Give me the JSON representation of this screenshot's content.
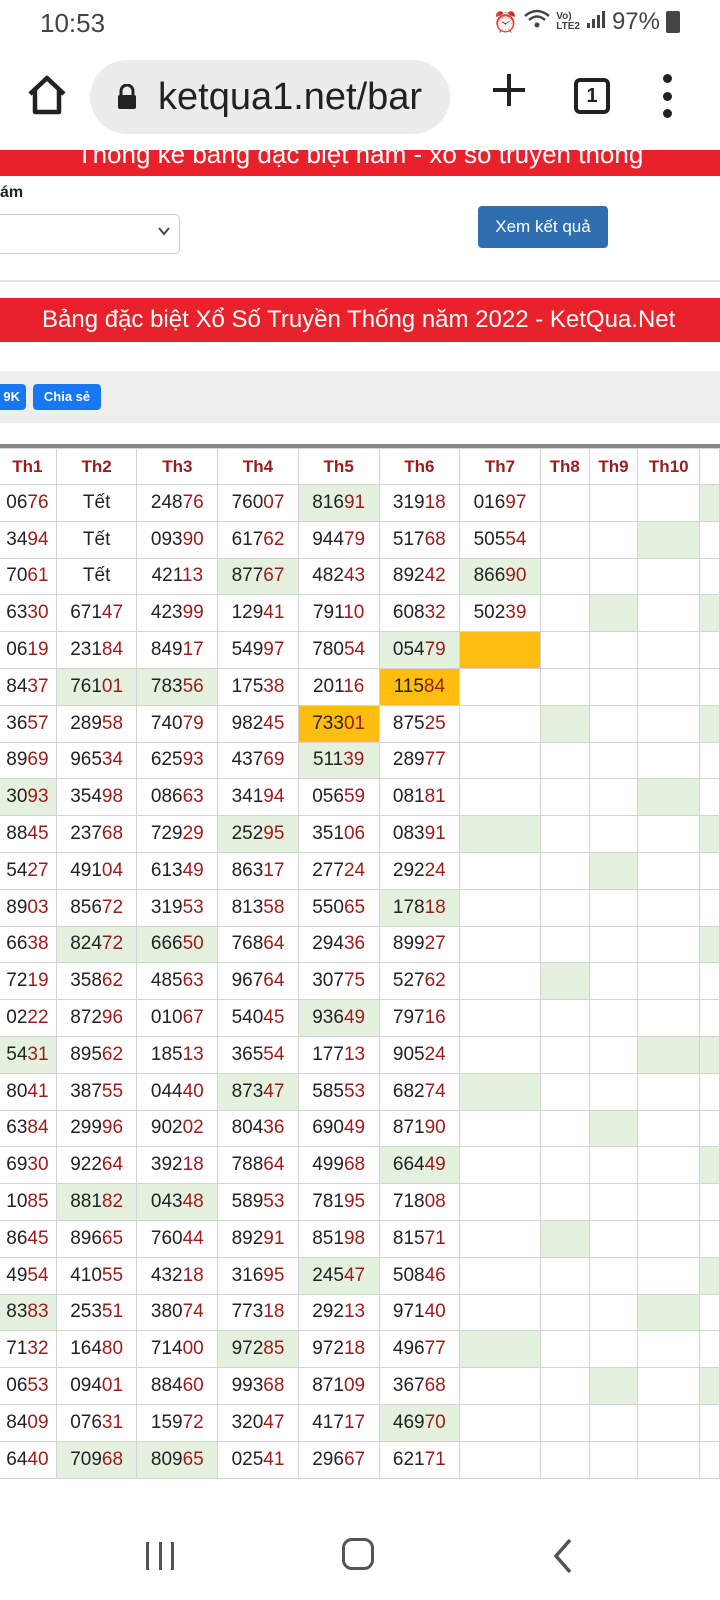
{
  "status": {
    "time": "10:53",
    "battery": "97%"
  },
  "browser": {
    "url": "ketqua1.net/bar",
    "tab_count": "1"
  },
  "form": {
    "top_banner": "Thống kê bảng đặc biệt năm - xổ số truyền thống",
    "year_label": "ám",
    "submit_label": "Xem kết quả"
  },
  "banner": "Bảng đặc biệt Xổ Số Truyền Thống năm 2022 - KetQua.Net",
  "share": {
    "count": "9K",
    "label": "Chia sẻ"
  },
  "table": {
    "headers": [
      "Th1",
      "Th2",
      "Th3",
      "Th4",
      "Th5",
      "Th6",
      "Th7",
      "Th8",
      "Th9",
      "Th10"
    ],
    "rows": [
      [
        "0676",
        "Tết",
        "24876",
        "76007",
        "81691",
        "31918",
        "01697",
        "",
        "",
        ""
      ],
      [
        "3494",
        "Tết",
        "09390",
        "61762",
        "94479",
        "51768",
        "50554",
        "",
        "",
        ""
      ],
      [
        "7061",
        "Tết",
        "42113",
        "87767",
        "48243",
        "89242",
        "86690",
        "",
        "",
        ""
      ],
      [
        "6330",
        "67147",
        "42399",
        "12941",
        "79110",
        "60832",
        "50239",
        "",
        "",
        ""
      ],
      [
        "0619",
        "23184",
        "84917",
        "54997",
        "78054",
        "05479",
        "",
        "",
        "",
        ""
      ],
      [
        "8437",
        "76101",
        "78356",
        "17538",
        "20116",
        "11584",
        "",
        "",
        "",
        ""
      ],
      [
        "3657",
        "28958",
        "74079",
        "98245",
        "73301",
        "87525",
        "",
        "",
        "",
        ""
      ],
      [
        "8969",
        "96534",
        "62593",
        "43769",
        "51139",
        "28977",
        "",
        "",
        "",
        ""
      ],
      [
        "3093",
        "35498",
        "08663",
        "34194",
        "05659",
        "08181",
        "",
        "",
        "",
        ""
      ],
      [
        "8845",
        "23768",
        "72929",
        "25295",
        "35106",
        "08391",
        "",
        "",
        "",
        ""
      ],
      [
        "5427",
        "49104",
        "61349",
        "86317",
        "27724",
        "29224",
        "",
        "",
        "",
        ""
      ],
      [
        "8903",
        "85672",
        "31953",
        "81358",
        "55065",
        "17818",
        "",
        "",
        "",
        ""
      ],
      [
        "6638",
        "82472",
        "66650",
        "76864",
        "29436",
        "89927",
        "",
        "",
        "",
        ""
      ],
      [
        "7219",
        "35862",
        "48563",
        "96764",
        "30775",
        "52762",
        "",
        "",
        "",
        ""
      ],
      [
        "0222",
        "87296",
        "01067",
        "54045",
        "93649",
        "79716",
        "",
        "",
        "",
        ""
      ],
      [
        "5431",
        "89562",
        "18513",
        "36554",
        "17713",
        "90524",
        "",
        "",
        "",
        ""
      ],
      [
        "8041",
        "38755",
        "04440",
        "87347",
        "58553",
        "68274",
        "",
        "",
        "",
        ""
      ],
      [
        "6384",
        "29996",
        "90202",
        "80436",
        "69049",
        "87190",
        "",
        "",
        "",
        ""
      ],
      [
        "6930",
        "92264",
        "39218",
        "78864",
        "49968",
        "66449",
        "",
        "",
        "",
        ""
      ],
      [
        "1085",
        "88182",
        "04348",
        "58953",
        "78195",
        "71808",
        "",
        "",
        "",
        ""
      ],
      [
        "8645",
        "89665",
        "76044",
        "89291",
        "85198",
        "81571",
        "",
        "",
        "",
        ""
      ],
      [
        "4954",
        "41055",
        "43218",
        "31695",
        "24547",
        "50846",
        "",
        "",
        "",
        ""
      ],
      [
        "8383",
        "25351",
        "38074",
        "77318",
        "29213",
        "97140",
        "",
        "",
        "",
        ""
      ],
      [
        "7132",
        "16480",
        "71400",
        "97285",
        "97218",
        "49677",
        "",
        "",
        "",
        ""
      ],
      [
        "0653",
        "09401",
        "88460",
        "99368",
        "87109",
        "36768",
        "",
        "",
        "",
        ""
      ],
      [
        "8409",
        "07631",
        "15972",
        "32047",
        "41717",
        "46970",
        "",
        "",
        "",
        ""
      ],
      [
        "6440",
        "70968",
        "80965",
        "02541",
        "29667",
        "62171",
        "",
        "",
        "",
        ""
      ]
    ],
    "highlights": {
      "green": [
        [
          0,
          4
        ],
        [
          1,
          9
        ],
        [
          2,
          3
        ],
        [
          2,
          6
        ],
        [
          3,
          8
        ],
        [
          4,
          5
        ],
        [
          5,
          1
        ],
        [
          5,
          2
        ],
        [
          6,
          7
        ],
        [
          6,
          4
        ],
        [
          7,
          4
        ],
        [
          8,
          0
        ],
        [
          8,
          9
        ],
        [
          9,
          3
        ],
        [
          9,
          6
        ],
        [
          10,
          8
        ],
        [
          11,
          5
        ],
        [
          12,
          1
        ],
        [
          12,
          2
        ],
        [
          13,
          7
        ],
        [
          14,
          4
        ],
        [
          15,
          0
        ],
        [
          15,
          9
        ],
        [
          16,
          3
        ],
        [
          16,
          6
        ],
        [
          17,
          8
        ],
        [
          18,
          5
        ],
        [
          19,
          1
        ],
        [
          19,
          2
        ],
        [
          20,
          7
        ],
        [
          21,
          4
        ],
        [
          22,
          0
        ],
        [
          22,
          9
        ],
        [
          23,
          3
        ],
        [
          23,
          6
        ],
        [
          24,
          8
        ],
        [
          25,
          5
        ],
        [
          26,
          1
        ],
        [
          26,
          2
        ]
      ],
      "orange": [
        [
          4,
          6
        ],
        [
          5,
          5
        ],
        [
          6,
          4
        ]
      ]
    }
  }
}
